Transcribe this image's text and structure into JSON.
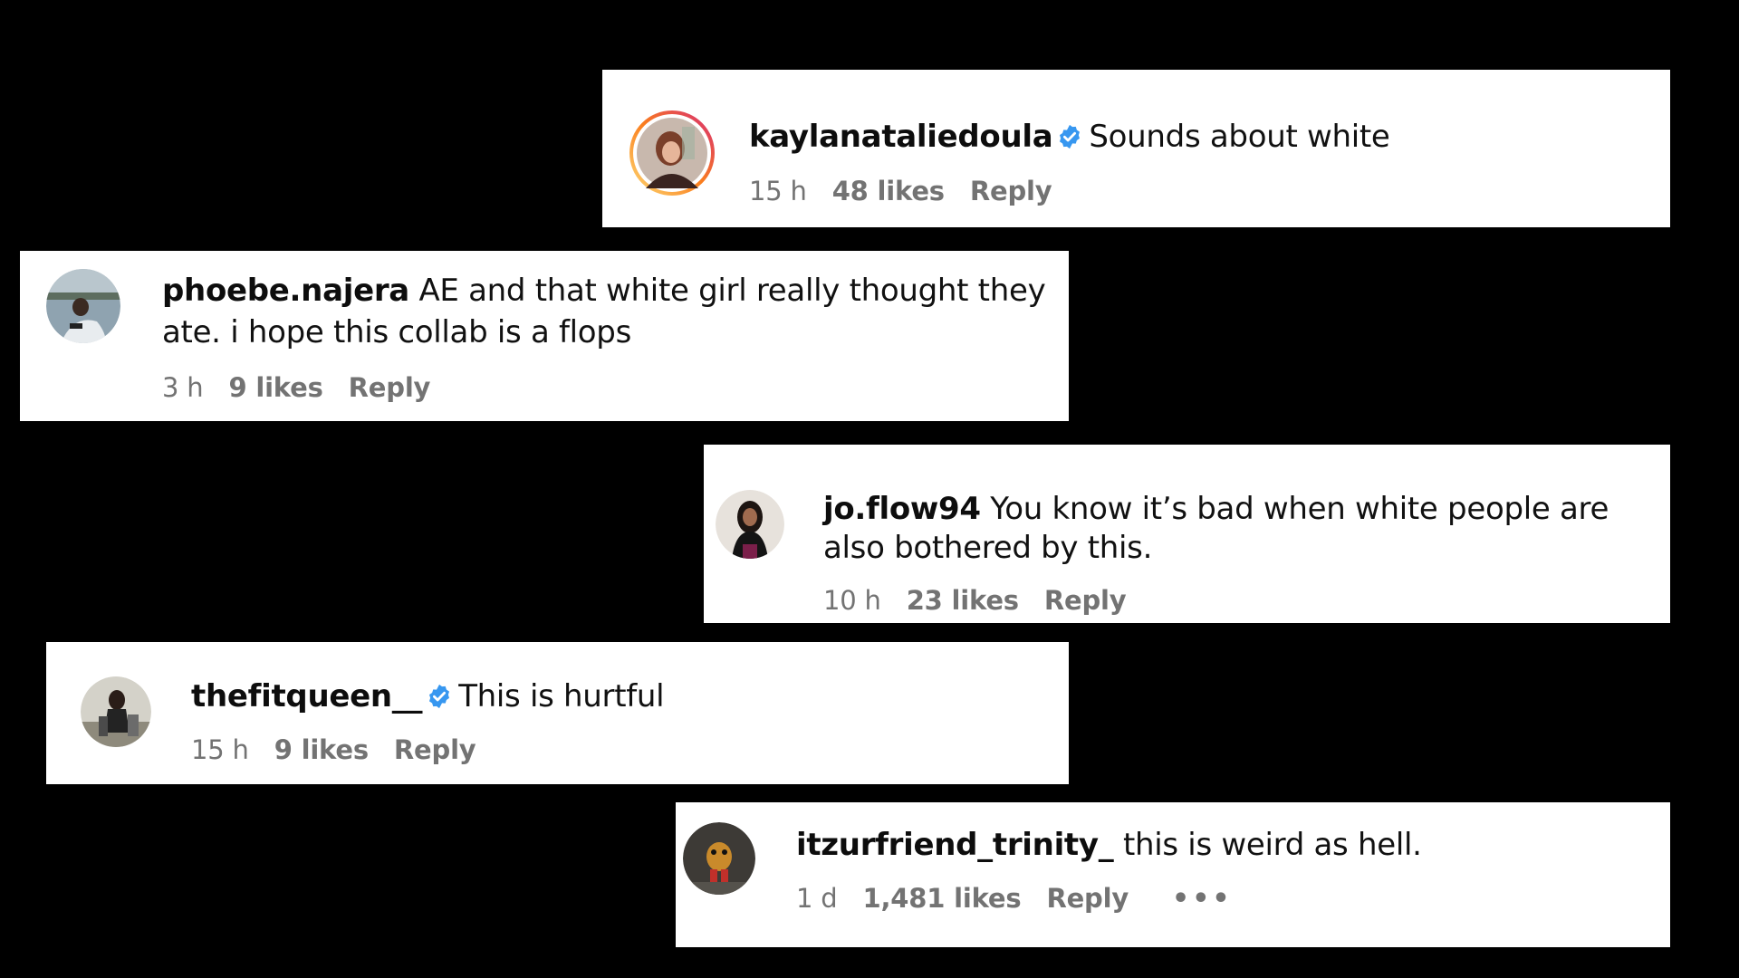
{
  "comments": [
    {
      "username": "kaylanataliedoula",
      "verified": true,
      "text": "Sounds about white",
      "time": "15 h",
      "likes": "48 likes",
      "reply": "Reply",
      "avatar_icon": "profile-photo-story-ring"
    },
    {
      "username": "phoebe.najera",
      "verified": false,
      "text": "AE and that white girl really thought they ate. i hope this collab is a flops",
      "time": "3 h",
      "likes": "9 likes",
      "reply": "Reply",
      "avatar_icon": "profile-photo"
    },
    {
      "username": "jo.flow94",
      "verified": false,
      "text": "You know it’s bad when white people are also bothered by this.",
      "time": "10 h",
      "likes": "23 likes",
      "reply": "Reply",
      "avatar_icon": "profile-photo"
    },
    {
      "username": "thefitqueen__",
      "verified": true,
      "text": "This is hurtful",
      "time": "15 h",
      "likes": "9 likes",
      "reply": "Reply",
      "avatar_icon": "profile-photo"
    },
    {
      "username": "itzurfriend_trinity_",
      "verified": false,
      "text": "this is weird as hell.",
      "time": "1 d",
      "likes": "1,481 likes",
      "reply": "Reply",
      "more": "•••",
      "avatar_icon": "profile-photo"
    }
  ],
  "colors": {
    "background": "#000000",
    "card": "#ffffff",
    "verified_badge": "#3797f0",
    "meta_text": "#737373",
    "story_ring_start": "#feda75",
    "story_ring_end": "#d62976"
  }
}
